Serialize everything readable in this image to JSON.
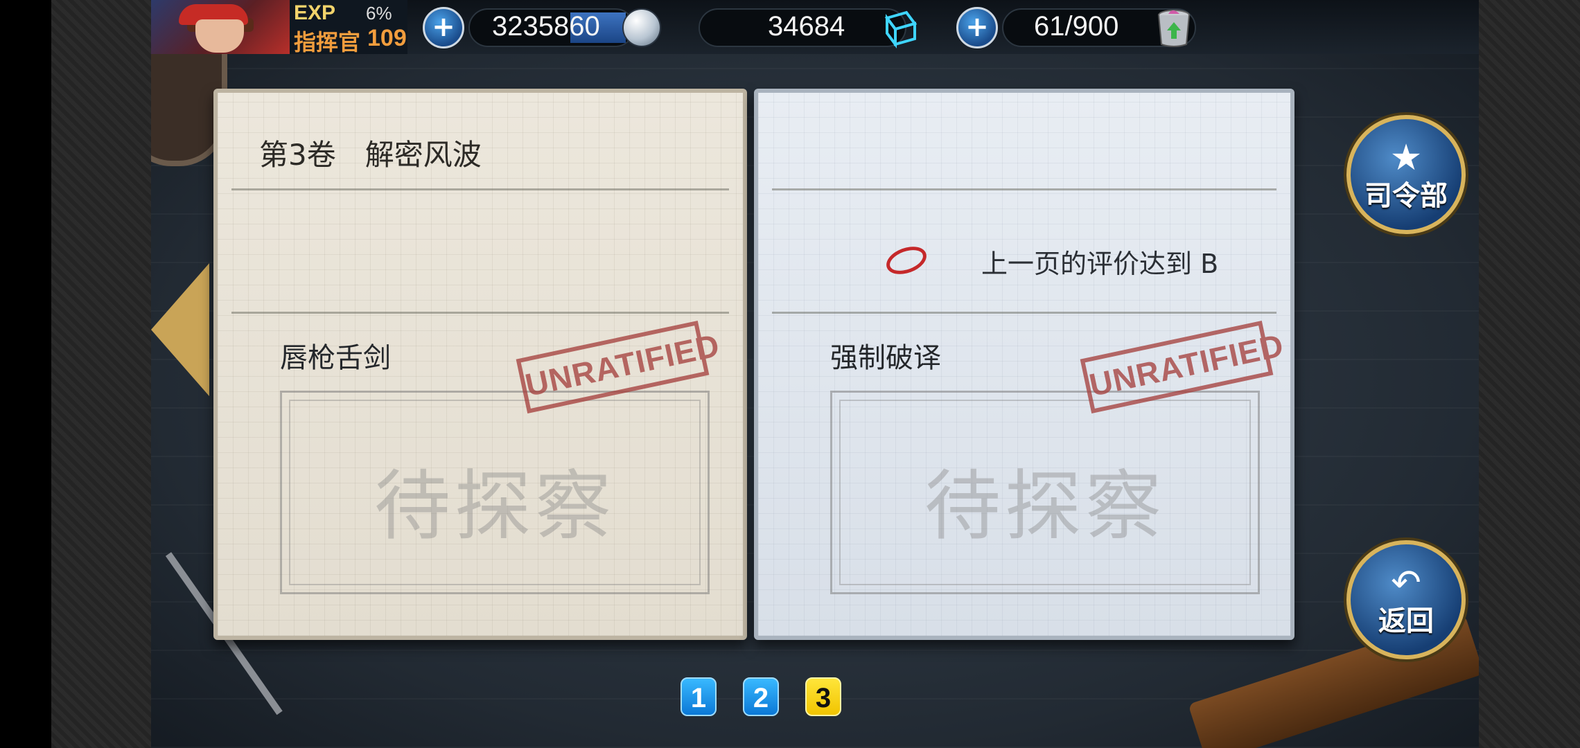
{
  "hud": {
    "exp_label": "EXP",
    "exp_percent": "6%",
    "rank": "指挥官",
    "level": "109",
    "coins": "3235860",
    "cubes": "34684",
    "energy": "61/900",
    "plus_symbol": "+"
  },
  "chapter": {
    "title": "第3卷　解密风波"
  },
  "left_page": {
    "stage_name": "唇枪舌剑",
    "stamp": "UNRATIFIED",
    "pending": "待探察"
  },
  "right_page": {
    "requirement": "上一页的评价达到  B",
    "stage_name": "强制破译",
    "stamp": "UNRATIFIED",
    "pending": "待探察"
  },
  "buttons": {
    "hq_label": "司令部",
    "back_label": "返回"
  },
  "pager": {
    "pages": [
      "1",
      "2",
      "3"
    ],
    "current": 3
  }
}
